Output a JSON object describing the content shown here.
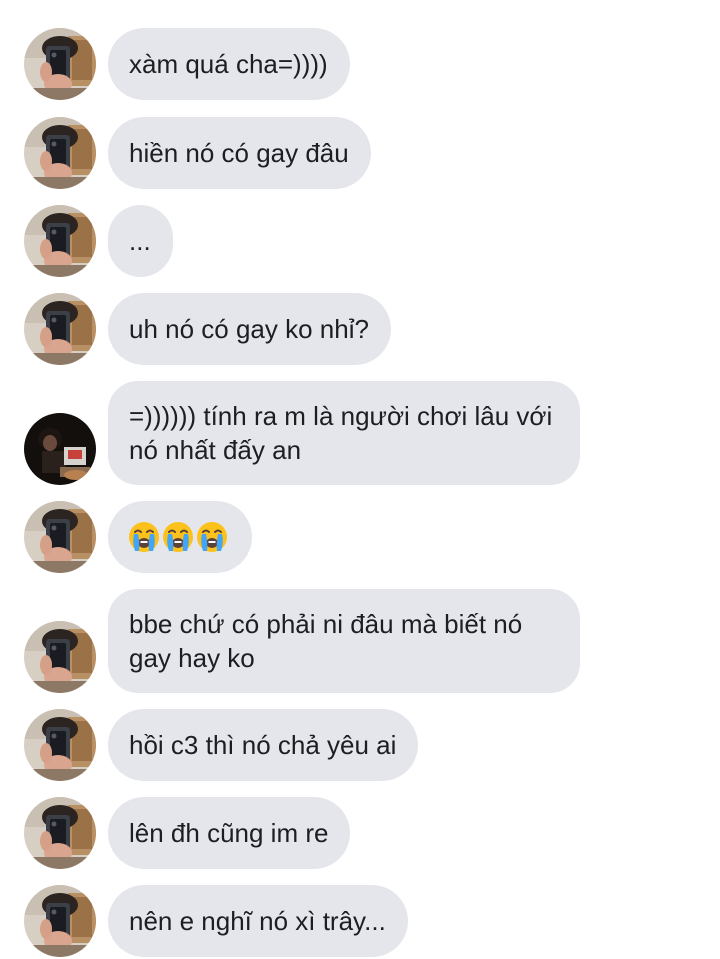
{
  "colors": {
    "bubble_bg": "#e4e6eb",
    "text": "#1c1e21",
    "background": "#ffffff"
  },
  "messages": [
    {
      "sender": "friend",
      "avatar": "friend-avatar",
      "text": "xàm quá cha=))))"
    },
    {
      "sender": "friend",
      "avatar": "friend-avatar",
      "text": "hiền nó có gay đâu"
    },
    {
      "sender": "friend",
      "avatar": "friend-avatar",
      "text": "..."
    },
    {
      "sender": "friend",
      "avatar": "friend-avatar",
      "text": "uh nó có gay ko nhỉ?"
    },
    {
      "sender": "other",
      "avatar": "other-avatar",
      "text": "=)))))) tính ra m là người chơi lâu với nó nhất đấy an"
    },
    {
      "sender": "friend",
      "avatar": "friend-avatar",
      "text": "",
      "emojis": [
        "loudly-crying-face",
        "loudly-crying-face",
        "loudly-crying-face"
      ]
    },
    {
      "sender": "friend",
      "avatar": "friend-avatar",
      "text": "bbe chứ có phải ni đâu mà biết nó gay hay ko"
    },
    {
      "sender": "friend",
      "avatar": "friend-avatar",
      "text": "hồi c3 thì nó chả yêu ai"
    },
    {
      "sender": "friend",
      "avatar": "friend-avatar",
      "text": "lên đh cũng im re"
    },
    {
      "sender": "friend",
      "avatar": "friend-avatar",
      "text": "nên e nghĩ nó xì trây..."
    }
  ]
}
